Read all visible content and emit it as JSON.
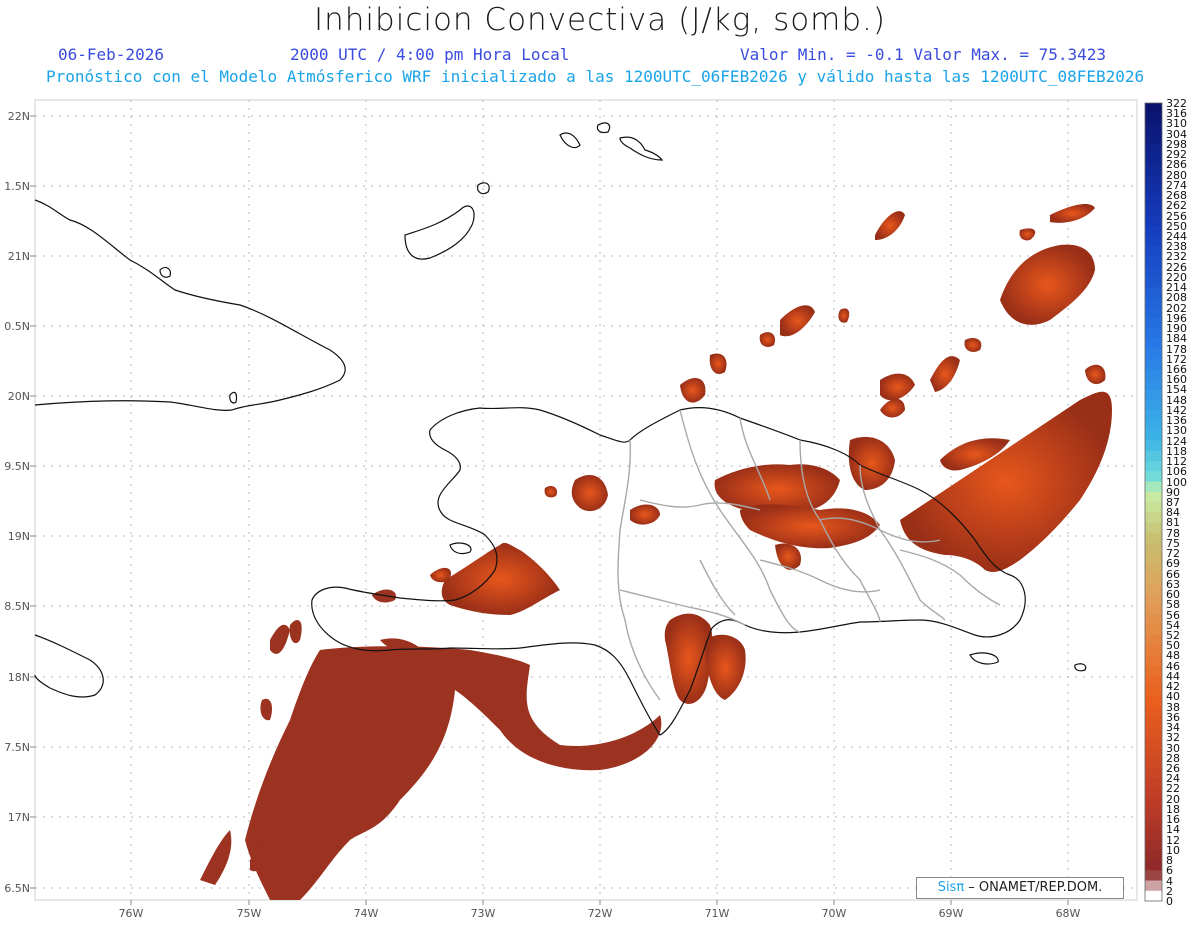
{
  "header": {
    "title": "Inhibicion Convectiva (J/kg, somb.)",
    "date": "06-Feb-2026",
    "time": "2000 UTC / 4:00 pm Hora Local",
    "minmax": "Valor Min. = -0.1  Valor Max. = 75.3423",
    "model_line": "Pronóstico con el Modelo Atmósferico WRF inicializado a las 1200UTC_06FEB2026 y válido hasta las  1200UTC_08FEB2026"
  },
  "axes": {
    "lat_labels": [
      "22N",
      "1.5N",
      "21N",
      "0.5N",
      "20N",
      "9.5N",
      "19N",
      "8.5N",
      "18N",
      "7.5N",
      "17N",
      "6.5N"
    ],
    "lon_labels": [
      "76W",
      "75W",
      "74W",
      "73W",
      "72W",
      "71W",
      "70W",
      "69W",
      "68W"
    ]
  },
  "colorbar": {
    "labels": [
      "322",
      "316",
      "310",
      "304",
      "298",
      "292",
      "286",
      "280",
      "274",
      "268",
      "262",
      "256",
      "250",
      "244",
      "238",
      "232",
      "226",
      "220",
      "214",
      "208",
      "202",
      "196",
      "190",
      "184",
      "178",
      "172",
      "166",
      "160",
      "154",
      "148",
      "142",
      "136",
      "130",
      "124",
      "118",
      "112",
      "106",
      "100",
      "90",
      "87",
      "84",
      "81",
      "78",
      "75",
      "72",
      "69",
      "66",
      "63",
      "60",
      "58",
      "56",
      "54",
      "52",
      "50",
      "48",
      "46",
      "44",
      "42",
      "40",
      "38",
      "36",
      "34",
      "32",
      "30",
      "28",
      "26",
      "24",
      "22",
      "20",
      "18",
      "16",
      "14",
      "12",
      "10",
      "8",
      "6",
      "4",
      "2",
      "0"
    ]
  },
  "credit": {
    "brand_a": "Sis",
    "brand_pi": "π",
    "text": " – ONAMET/REP.DOM."
  }
}
